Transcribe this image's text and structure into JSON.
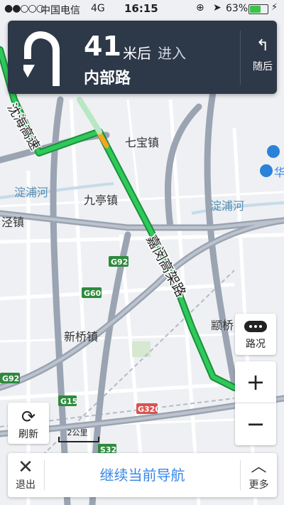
{
  "status_bar": {
    "signal": "●●○○○",
    "carrier": "中国电信",
    "network": "4G",
    "time": "16:15",
    "battery": "63%",
    "battery_level": 0.63
  },
  "guidance": {
    "distance": "41",
    "unit": "米后",
    "action": "进入",
    "road": "内部路",
    "next_turn_label": "随后"
  },
  "map": {
    "labels": {
      "shenhai": "沈海高速",
      "qibao": "七宝镇",
      "jiuting": "九亭镇",
      "dianpu_w": "淀浦河",
      "dianpu_e": "淀浦河",
      "sijing": "泾镇",
      "jiamin": "嘉闵高架路",
      "xinqiao": "新桥镇",
      "hongqiao": "颛桥",
      "hua": "华"
    },
    "shields": {
      "g92a": "G92",
      "g60": "G60",
      "g92b": "G92",
      "g15": "G15",
      "g320": "G320",
      "s32": "S32"
    },
    "scale_label": "2公里"
  },
  "controls": {
    "traffic_label": "路况",
    "zoom_in": "+",
    "zoom_out": "−",
    "refresh_label": "刷新"
  },
  "bottom_bar": {
    "exit_label": "退出",
    "continue_label": "继续当前导航",
    "more_label": "更多"
  }
}
